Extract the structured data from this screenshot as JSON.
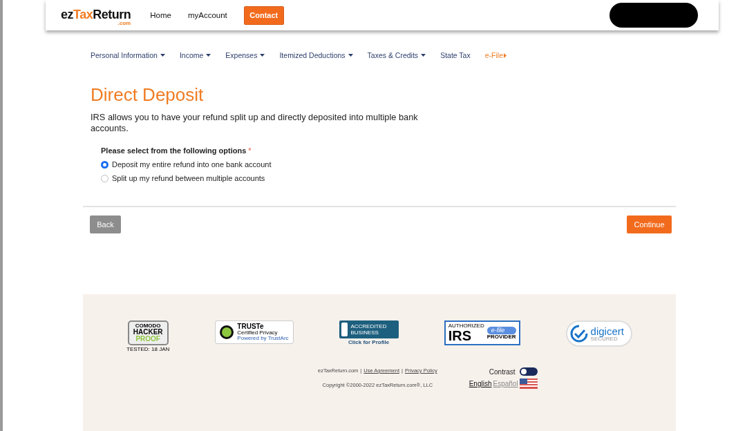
{
  "header": {
    "logo": {
      "brand_dark_1": "ez",
      "brand_accent": "Tax",
      "brand_dark_2": "Return",
      "suffix": ".com"
    },
    "links": [
      "Home",
      "myAccount"
    ],
    "contact_button": "Contact"
  },
  "nav": [
    {
      "label": "Personal Information",
      "has_menu": true,
      "selected": false
    },
    {
      "label": "Income",
      "has_menu": true,
      "selected": false
    },
    {
      "label": "Expenses",
      "has_menu": true,
      "selected": false
    },
    {
      "label": "Itemized Deductions",
      "has_menu": true,
      "selected": false
    },
    {
      "label": "Taxes & Credits",
      "has_menu": true,
      "selected": false
    },
    {
      "label": "State Tax",
      "has_menu": false,
      "selected": false
    },
    {
      "label": "e-File",
      "has_menu": false,
      "selected": true
    }
  ],
  "title": "Direct Deposit",
  "intro": "IRS allows you to have your refund split up and directly deposited into multiple bank accounts.",
  "question": {
    "label": "Please select from the following options",
    "required": true,
    "required_mark": "*"
  },
  "options": [
    {
      "label": "Deposit my entire refund into one bank account",
      "selected": true
    },
    {
      "label": "Split up my refund between multiple accounts",
      "selected": false
    }
  ],
  "buttons": {
    "back": "Back",
    "continue": "Continue"
  },
  "footer": {
    "badges": [
      {
        "kind": "hacker",
        "texts": [
          "COMODO",
          "HACKER",
          "PROOF",
          "TESTED: 18 JAN"
        ]
      },
      {
        "kind": "truste",
        "texts": [
          "TRUSTe",
          "Certified Privacy",
          "Powered by TrustArc"
        ]
      },
      {
        "kind": "bbb",
        "texts": [
          "ACCREDITED BUSINESS",
          "Click for Profile"
        ]
      },
      {
        "kind": "irs",
        "texts": [
          "AUTHORIZED",
          "IRS",
          "e-file",
          "PROVIDER"
        ]
      },
      {
        "kind": "digicert",
        "texts": [
          "digicert",
          "SECURED"
        ]
      }
    ],
    "site": "ezTaxReturn.com",
    "links": [
      "Use Agreement",
      "Privacy Policy"
    ],
    "separator": "|",
    "copyright": "Copyright ©2000-2022 ezTaxReturn.com®, LLC",
    "contrast": {
      "label": "Contrast",
      "on": false
    },
    "languages": [
      {
        "label": "English",
        "selected": true
      },
      {
        "label": "Español",
        "selected": false
      }
    ]
  }
}
